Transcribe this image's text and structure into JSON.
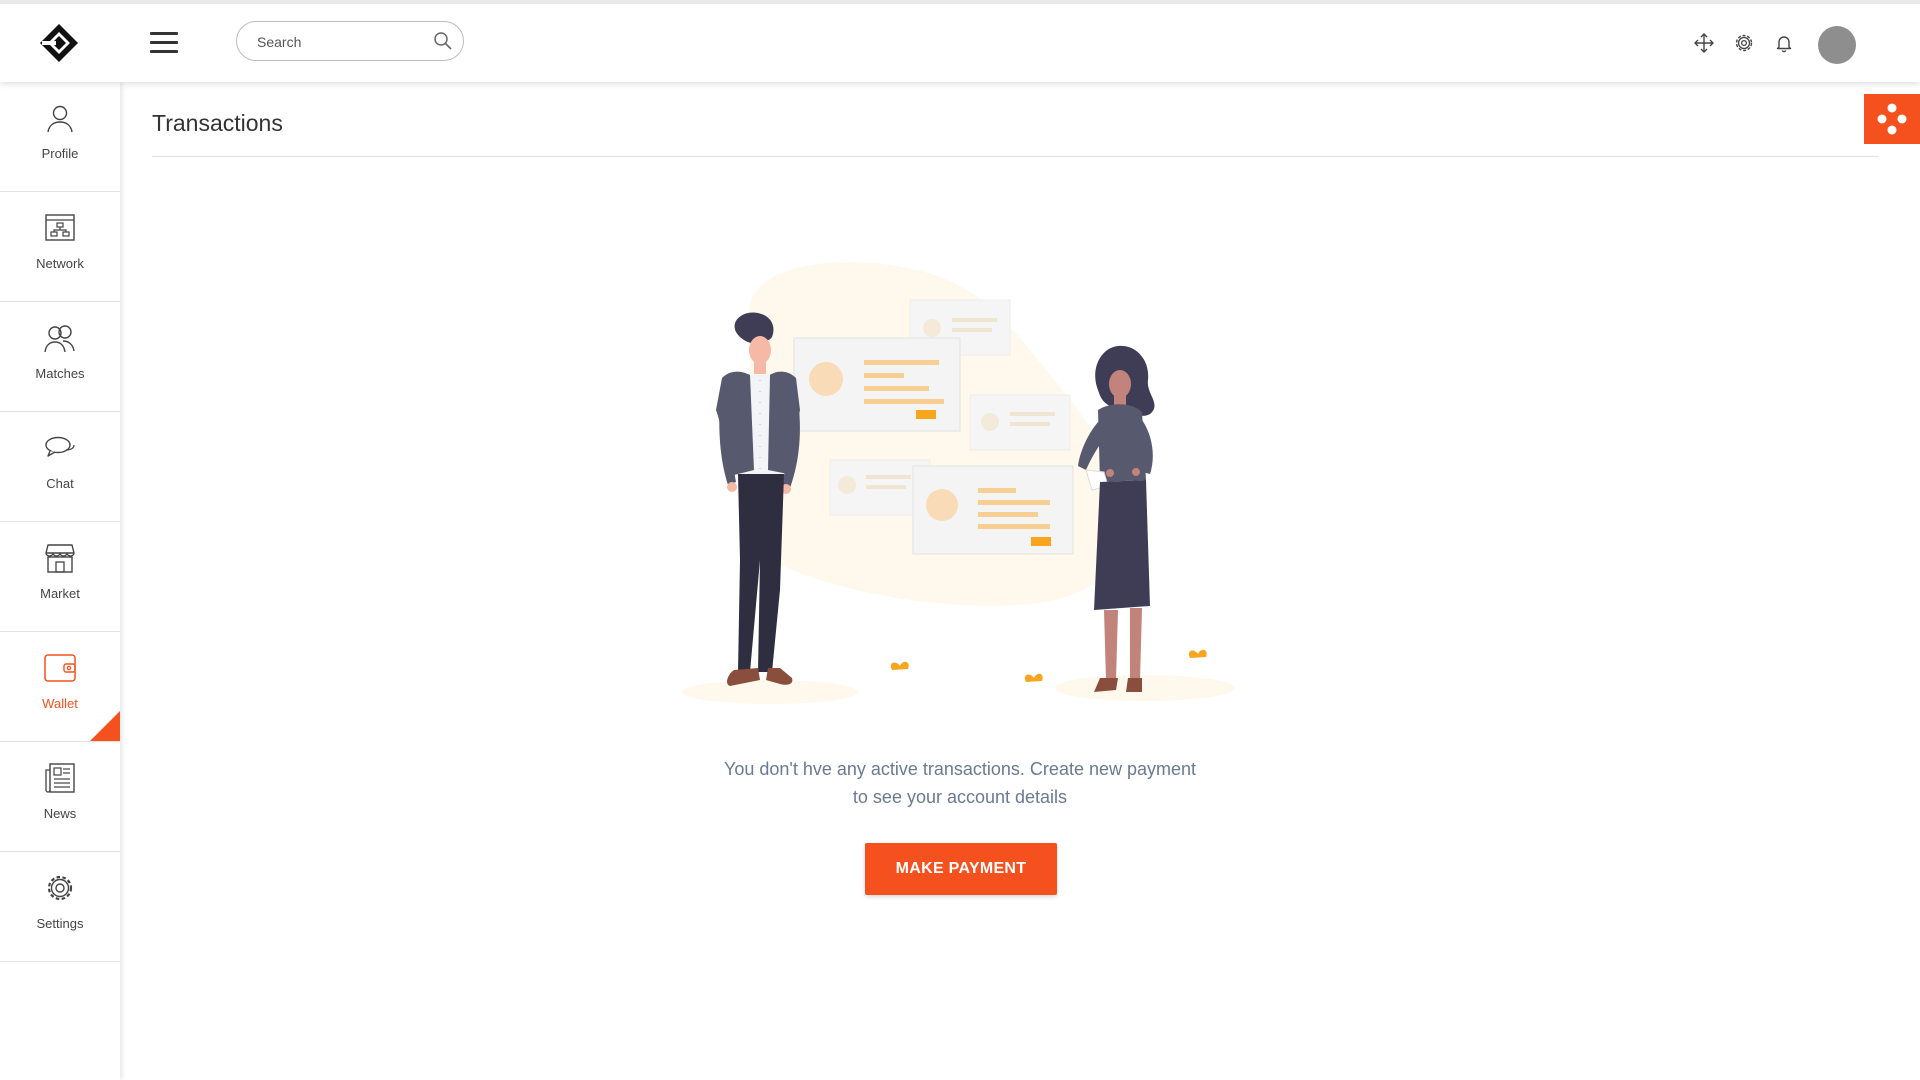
{
  "header": {
    "search_placeholder": "Search",
    "icons": [
      "logo-icon",
      "hamburger-icon",
      "search-icon",
      "move-icon",
      "gear-icon",
      "bell-icon",
      "avatar"
    ]
  },
  "sidebar": {
    "items": [
      {
        "label": "Profile",
        "icon": "profile-icon"
      },
      {
        "label": "Network",
        "icon": "network-icon"
      },
      {
        "label": "Matches",
        "icon": "matches-icon"
      },
      {
        "label": "Chat",
        "icon": "chat-icon"
      },
      {
        "label": "Market",
        "icon": "market-icon"
      },
      {
        "label": "Wallet",
        "icon": "wallet-icon",
        "active": true
      },
      {
        "label": "News",
        "icon": "news-icon"
      },
      {
        "label": "Settings",
        "icon": "settings-icon"
      }
    ]
  },
  "main": {
    "title": "Transactions",
    "empty_message_line1": "You don't hve any active transactions. Create new payment",
    "empty_message_line2": "to see your account details",
    "button_label": "MAKE PAYMENT"
  },
  "colors": {
    "accent": "#f4511e",
    "message_text": "#6a7a92",
    "avatar": "#8e8e8e"
  }
}
